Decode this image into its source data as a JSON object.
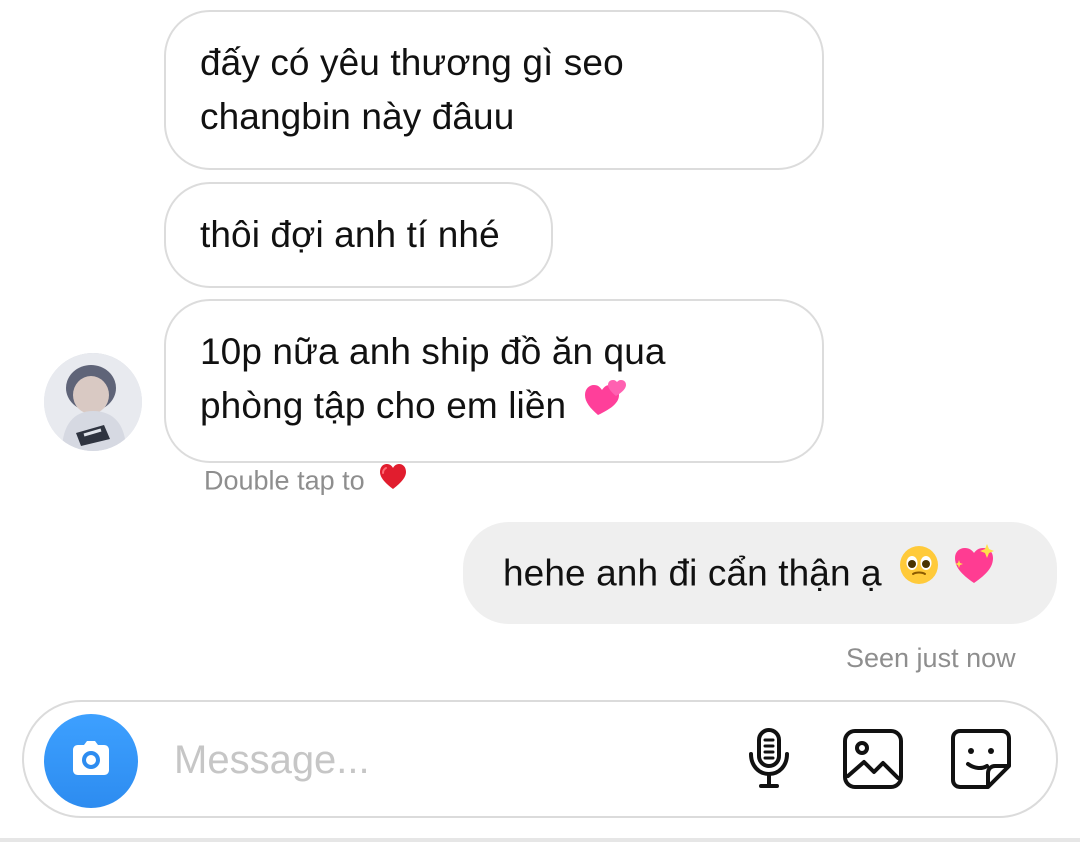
{
  "conversation": {
    "messages": [
      {
        "line1": "đấy có yêu thương gì seo",
        "line2": "changbin này đâuu"
      },
      {
        "text": "thôi đợi anh tí nhé"
      },
      {
        "line1": "10p nữa anh ship đồ ăn qua",
        "line2": "phòng tập cho em liền"
      },
      {
        "text": "hehe anh đi cẩn thận ạ"
      }
    ],
    "double_tap_text": "Double tap to",
    "seen_text": "Seen just now"
  },
  "composer": {
    "placeholder": "Message..."
  },
  "icons": {
    "camera": "camera-icon",
    "microphone": "microphone-icon",
    "gallery": "gallery-icon",
    "sticker": "sticker-icon"
  },
  "colors": {
    "incoming_bubble_border": "#dcdcdc",
    "outgoing_bubble": "#efefef",
    "accent_blue": "#2d8cf0",
    "meta_text": "#8e8e8e",
    "placeholder_text": "#c6c6c6"
  }
}
